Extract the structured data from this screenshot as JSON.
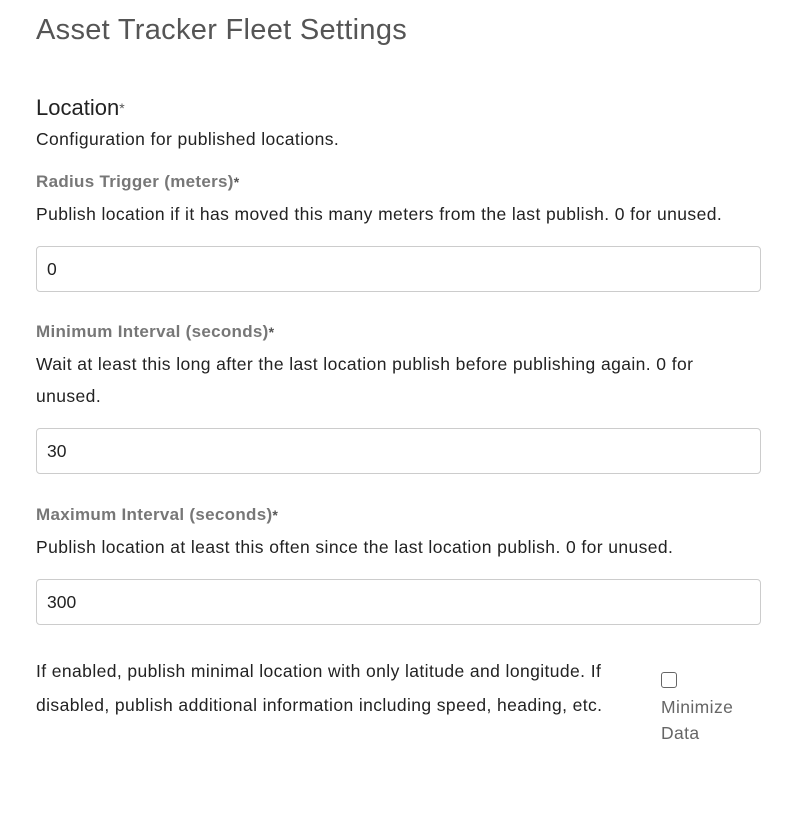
{
  "page_title": "Asset Tracker Fleet Settings",
  "section": {
    "title": "Location",
    "required_mark": "*",
    "description": "Configuration for published locations."
  },
  "fields": [
    {
      "label": "Radius Trigger (meters)",
      "required_mark": "*",
      "description": "Publish location if it has moved this many meters from the last publish. 0 for unused.",
      "value": "0"
    },
    {
      "label": "Minimum Interval (seconds)",
      "required_mark": "*",
      "description": "Wait at least this long after the last location publish before publishing again. 0 for unused.",
      "value": "30"
    },
    {
      "label": "Maximum Interval (seconds)",
      "required_mark": "*",
      "description": "Publish location at least this often since the last location publish. 0 for unused.",
      "value": "300"
    }
  ],
  "minimize": {
    "description": "If enabled, publish minimal location with only latitude and longitude. If disabled, publish additional information including speed, heading, etc.",
    "label": "Minimize Data",
    "checked": false
  }
}
